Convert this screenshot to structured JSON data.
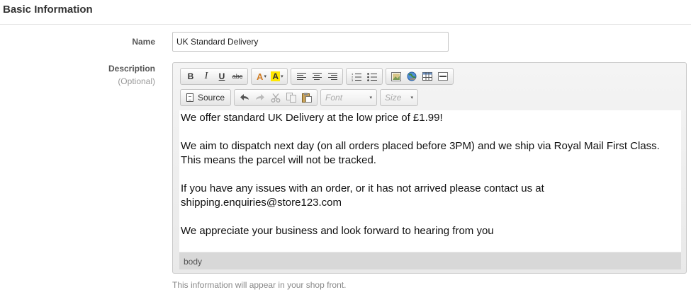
{
  "section": {
    "title": "Basic Information"
  },
  "name_field": {
    "label": "Name",
    "value": "UK Standard Delivery"
  },
  "description_field": {
    "label": "Description",
    "optional_label": "(Optional)",
    "help_text": "This information will appear in your shop front."
  },
  "toolbar": {
    "bold": "B",
    "italic": "I",
    "underline": "U",
    "strike": "abc",
    "text_color": "A",
    "bg_color": "A",
    "source": "Source",
    "font_placeholder": "Font",
    "size_placeholder": "Size",
    "dropdown_arrow": "▾"
  },
  "editor": {
    "paragraphs": [
      "We offer standard UK Delivery at the low price of £1.99!",
      "We aim to dispatch next day (on all orders placed before 3PM) and we ship via Royal Mail First Class. This means the parcel will not be tracked.",
      "If you have any issues with an order, or it has not arrived please contact us at shipping.enquiries@store123.com",
      "We appreciate your business and look forward to hearing from you"
    ],
    "status_path": "body"
  },
  "colors": {
    "text_color_swatch": "#d07a20",
    "highlight_swatch": "#ffe800",
    "status_bar": "#d8d8d8"
  }
}
